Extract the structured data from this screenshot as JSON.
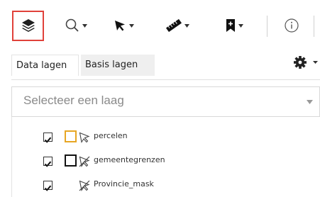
{
  "toolbar": {
    "icons": [
      "layers-icon",
      "search-icon",
      "select-arrow-icon",
      "measure-icon",
      "bookmark-icon",
      "info-icon"
    ],
    "active_color": "#e0413a"
  },
  "tabs": [
    {
      "label": "Data lagen",
      "active": true
    },
    {
      "label": "Basis lagen",
      "active": false
    }
  ],
  "layer_select": {
    "placeholder": "Selecteer een laag"
  },
  "layers": [
    {
      "name": "percelen",
      "checked": true,
      "swatch_color": "#e7a623",
      "icon": "feature-select-icon"
    },
    {
      "name": "gemeentegrenzen",
      "checked": true,
      "swatch_color": "#111111",
      "icon": "feature-select-disabled-icon"
    },
    {
      "name": "Provincie_mask",
      "checked": true,
      "swatch_color": "",
      "icon": "feature-select-disabled-icon"
    }
  ]
}
